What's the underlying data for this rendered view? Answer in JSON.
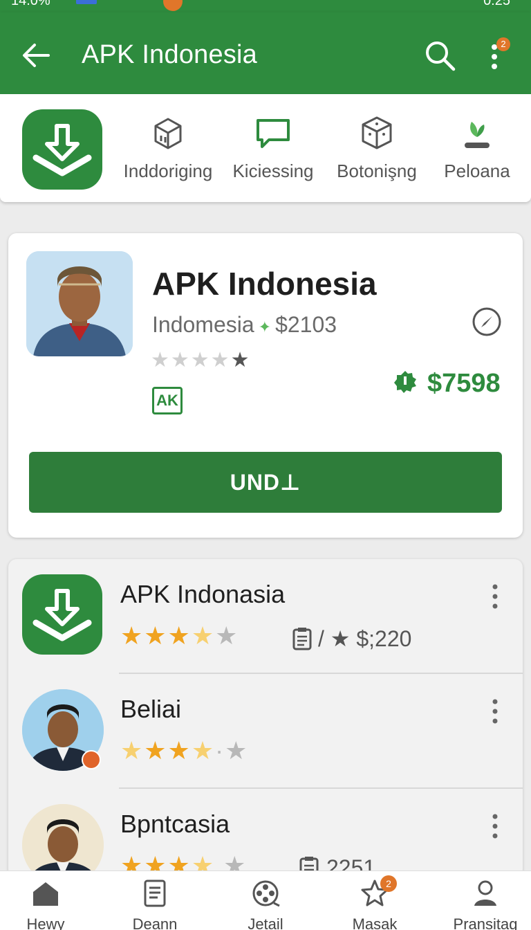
{
  "status_bar": {
    "left_text": "14.0%",
    "right_text": "0:25"
  },
  "app_bar": {
    "title": "APK Indonesia",
    "more_badge": "2"
  },
  "categories": [
    {
      "label": "Inddoriging",
      "icon": "box-icon"
    },
    {
      "label": "Kiciessing",
      "icon": "chat-icon"
    },
    {
      "label": "Botonişng",
      "icon": "cube-icon"
    },
    {
      "label": "Peloana",
      "icon": "plant-icon"
    }
  ],
  "featured": {
    "name": "APK Indonesia",
    "subtitle_left": "Indomesia",
    "subtitle_price": "$2103",
    "rating_stars": "★★★★",
    "rating_dark_star": "★",
    "tag": "AK",
    "price": "$7598",
    "install_label": "UND⊥"
  },
  "list": [
    {
      "name": "APK Indonasia",
      "meta": "/ ★ $;220"
    },
    {
      "name": "Beliai",
      "meta": ""
    },
    {
      "name": "Bpntcasia",
      "meta": "2251 ̥"
    }
  ],
  "bottom_nav": [
    {
      "label": "Hewy",
      "icon": "home-icon"
    },
    {
      "label": "Deann",
      "icon": "document-icon"
    },
    {
      "label": "Jetail",
      "icon": "film-reel-icon"
    },
    {
      "label": "Masak",
      "icon": "star-icon",
      "badge": "2"
    },
    {
      "label": "Pransitag",
      "icon": "person-icon"
    }
  ],
  "colors": {
    "primary": "#2e8b3e",
    "accent_badge": "#e0762a",
    "star": "#f0a320"
  }
}
